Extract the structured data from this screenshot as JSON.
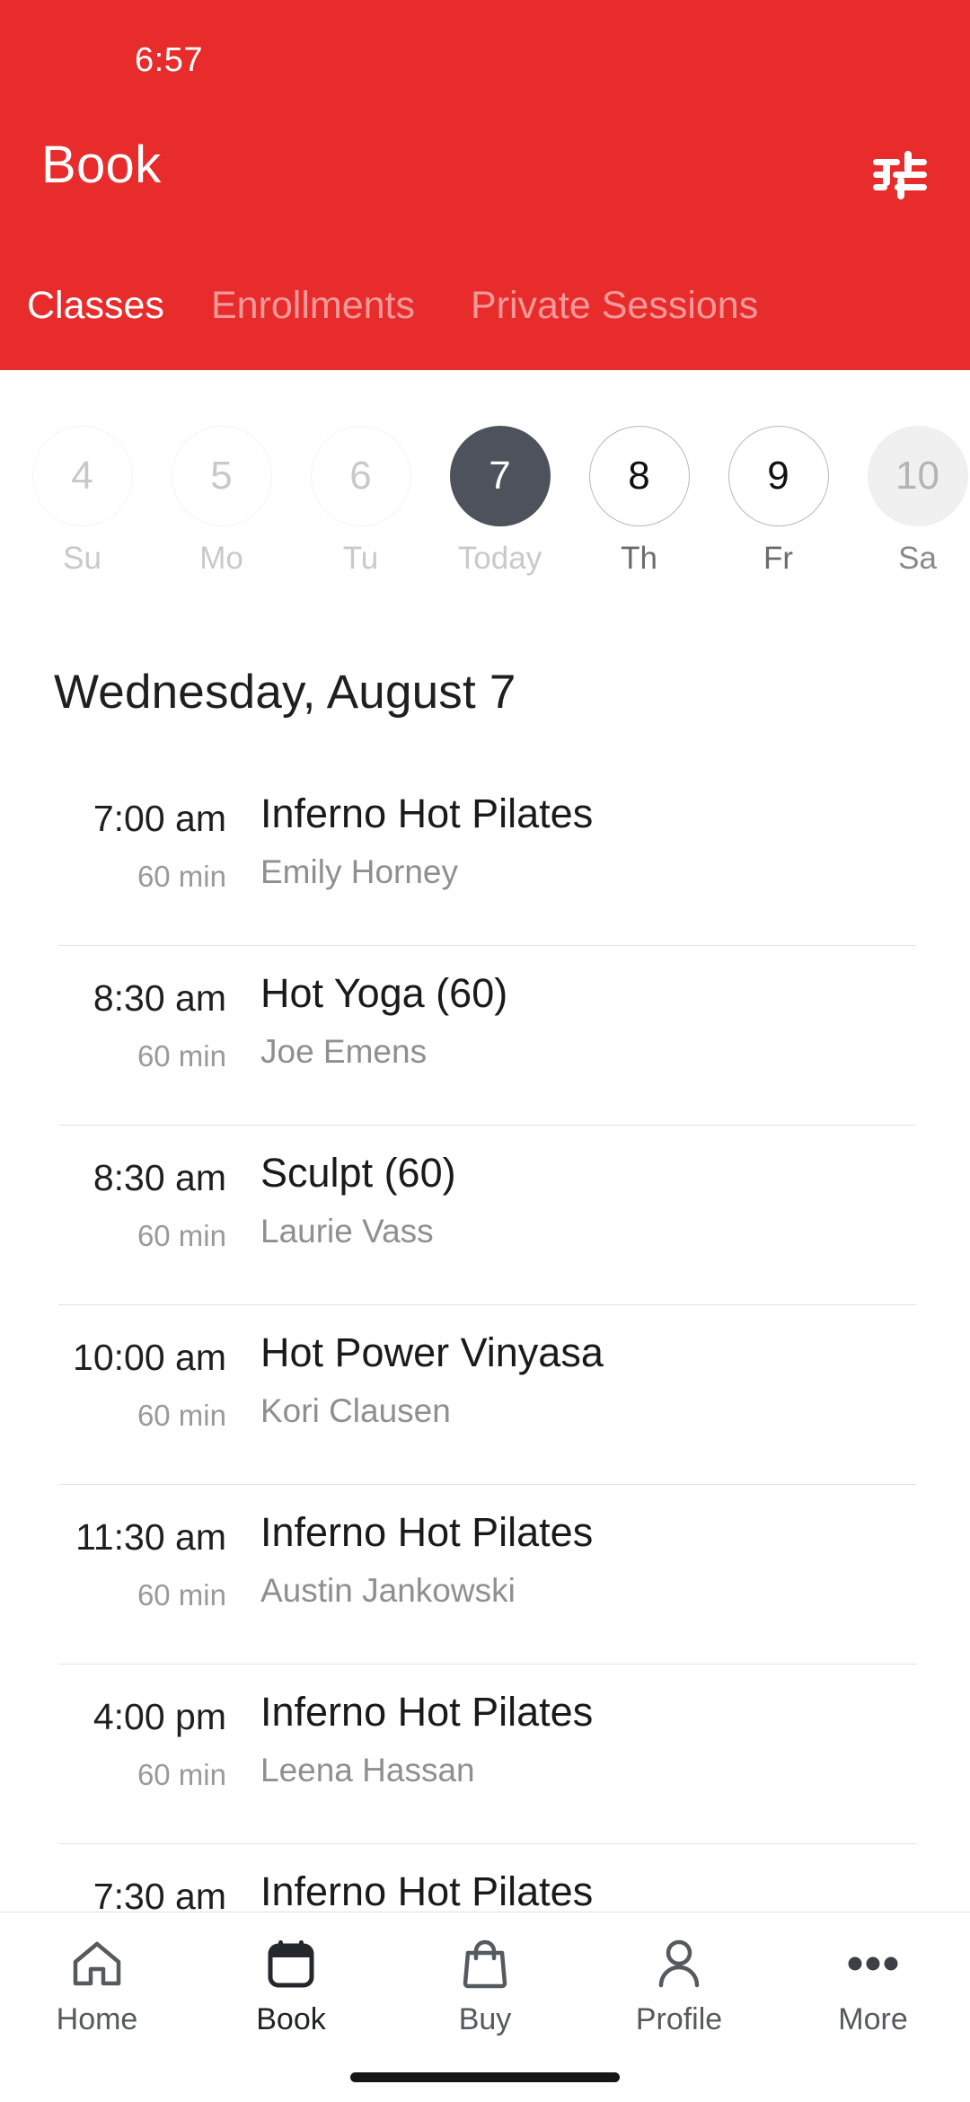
{
  "status_bar": {
    "time": "6:57"
  },
  "header": {
    "title": "Book",
    "accent_color": "#e82b2b",
    "filter_icon": "tune-sliders-icon",
    "tabs": [
      {
        "label": "Classes",
        "active": true
      },
      {
        "label": "Enrollments",
        "active": false
      },
      {
        "label": "Private Sessions",
        "active": false
      }
    ]
  },
  "date_strip": {
    "selected_color": "#4e525c",
    "days": [
      {
        "number": "4",
        "label": "Su",
        "state": "past"
      },
      {
        "number": "5",
        "label": "Mo",
        "state": "past"
      },
      {
        "number": "6",
        "label": "Tu",
        "state": "past"
      },
      {
        "number": "7",
        "label": "Today",
        "state": "selected"
      },
      {
        "number": "8",
        "label": "Th",
        "state": "future"
      },
      {
        "number": "9",
        "label": "Fr",
        "state": "future"
      },
      {
        "number": "10",
        "label": "Sa",
        "state": "edge"
      }
    ]
  },
  "schedule": {
    "day_heading": "Wednesday, August 7",
    "classes": [
      {
        "time": "7:00 am",
        "duration": "60 min",
        "name": "Inferno Hot Pilates",
        "instructor": "Emily Horney"
      },
      {
        "time": "8:30 am",
        "duration": "60 min",
        "name": "Hot Yoga (60)",
        "instructor": "Joe Emens"
      },
      {
        "time": "8:30 am",
        "duration": "60 min",
        "name": "Sculpt (60)",
        "instructor": "Laurie Vass"
      },
      {
        "time": "10:00 am",
        "duration": "60 min",
        "name": "Hot Power Vinyasa",
        "instructor": "Kori Clausen"
      },
      {
        "time": "11:30 am",
        "duration": "60 min",
        "name": "Inferno Hot Pilates",
        "instructor": "Austin Jankowski"
      },
      {
        "time": "4:00 pm",
        "duration": "60 min",
        "name": "Inferno Hot Pilates",
        "instructor": "Leena Hassan"
      },
      {
        "time": "7:30 am",
        "duration": "",
        "name": "Inferno Hot Pilates",
        "instructor": ""
      }
    ]
  },
  "bottom_nav": {
    "items": [
      {
        "label": "Home",
        "icon": "house-icon",
        "active": false
      },
      {
        "label": "Book",
        "icon": "calendar-icon",
        "active": true
      },
      {
        "label": "Buy",
        "icon": "shopping-bag-icon",
        "active": false
      },
      {
        "label": "Profile",
        "icon": "person-icon",
        "active": false
      },
      {
        "label": "More",
        "icon": "ellipsis-icon",
        "active": false
      }
    ]
  }
}
